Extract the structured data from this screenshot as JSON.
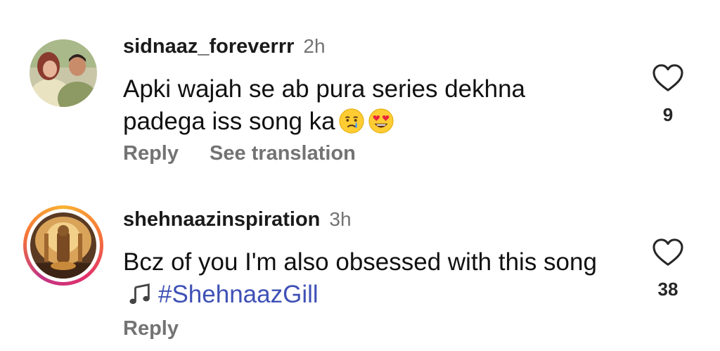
{
  "comments": [
    {
      "username": "sidnaaz_foreverrr",
      "time": "2h",
      "text": "Apki wajah se ab pura series dekhna padega iss song ka",
      "emojis": [
        "crying-face",
        "heart-eyes-face"
      ],
      "actions": {
        "reply": "Reply",
        "translate": "See translation"
      },
      "likes": "9"
    },
    {
      "username": "shehnaazinspiration",
      "time": "3h",
      "text": "Bcz of you I'm also obsessed with this song",
      "emojis": [
        "musical-note"
      ],
      "hashtag": "#ShehnaazGill",
      "actions": {
        "reply": "Reply"
      },
      "likes": "38",
      "has_story_ring": true
    }
  ],
  "colors": {
    "hashtag": "#3f51b5",
    "secondary_text": "#737373",
    "story_ring": "#e1306c"
  }
}
